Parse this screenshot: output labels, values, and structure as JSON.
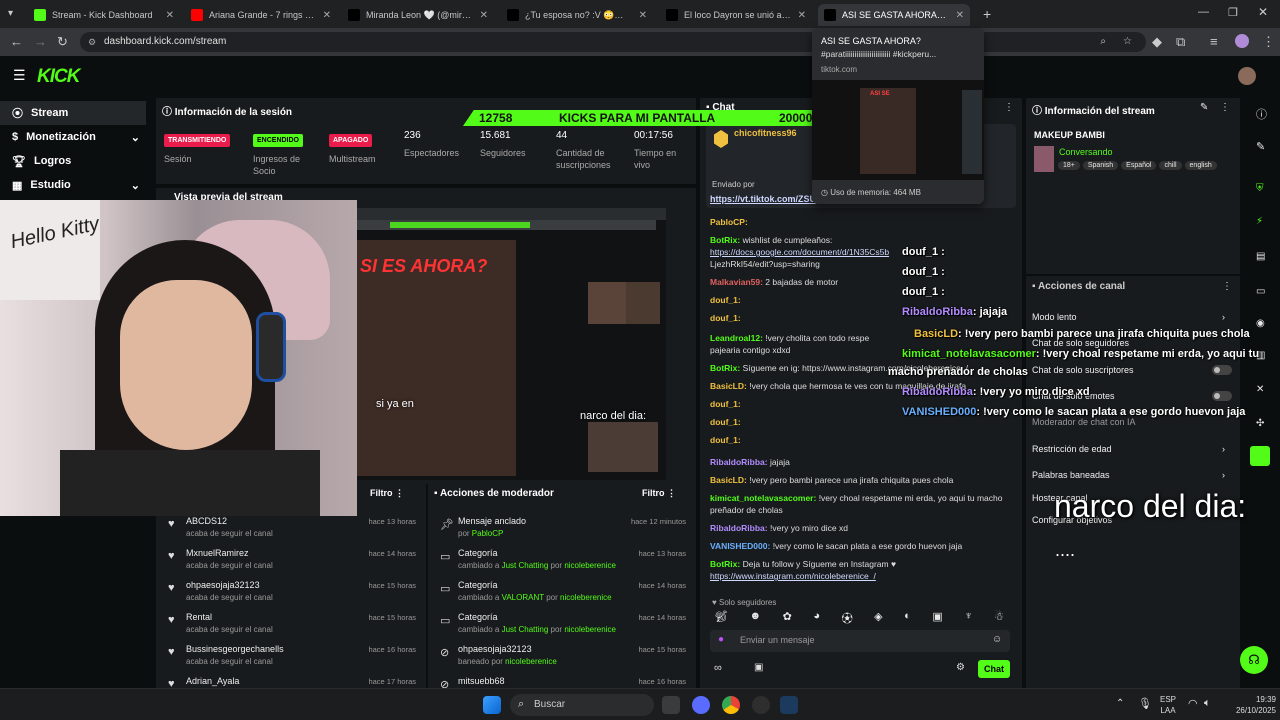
{
  "browser": {
    "tabs": [
      {
        "label": "Stream - Kick Dashboard",
        "favicon": "kick-icon",
        "color": "#53fc18"
      },
      {
        "label": "Ariana Grande - 7 rings (Official",
        "favicon": "youtube-icon",
        "color": "#ff0000"
      },
      {
        "label": "Miranda Leon 🤍 (@mirandita",
        "favicon": "tiktok-icon",
        "color": "#000000"
      },
      {
        "label": "¿Tu esposa no? :V 😳💀 #king",
        "favicon": "tiktok-icon",
        "color": "#000000"
      },
      {
        "label": "El loco Dayron se unió a los sal",
        "favicon": "tiktok-icon",
        "color": "#000000"
      },
      {
        "label": "ASI SE GASTA AHORA? #parati",
        "favicon": "tiktok-icon",
        "color": "#000000"
      }
    ],
    "url": "dashboard.kick.com/stream",
    "tooltip": {
      "title": "ASI SE GASTA AHORA?",
      "subtitle": "#paratiiiiiiiiiiiiiiiiiiiiiiii #kickperu...",
      "domain": "tiktok.com",
      "memory": "Uso de memoria: 464 MB"
    }
  },
  "nav": {
    "items": [
      {
        "label": "Stream",
        "icon": "stream-icon"
      },
      {
        "label": "Monetización",
        "icon": "dollar-icon"
      },
      {
        "label": "Logros",
        "icon": "trophy-icon"
      },
      {
        "label": "Estudio",
        "icon": "studio-icon"
      }
    ]
  },
  "session": {
    "title": "Información de la sesión",
    "status": [
      {
        "badge": "TRANSMITIENDO",
        "label": "Sesión",
        "color": "#e91c4b",
        "text": "#ffffff"
      },
      {
        "badge": "ENCENDIDO",
        "label": "Ingresos de Socio",
        "color": "#53fc18",
        "text": "#000000"
      },
      {
        "badge": "APAGADO",
        "label": "Multistream",
        "color": "#e91c4b",
        "text": "#ffffff"
      }
    ],
    "stats": [
      {
        "value": "236",
        "label": "Espectadores"
      },
      {
        "value": "15.681",
        "label": "Seguidores"
      },
      {
        "value": "44",
        "label": "Cantidad de suscripciones"
      },
      {
        "value": "00:17:56",
        "label": "Tiempo en vivo"
      }
    ]
  },
  "overlay": {
    "kicks_current": "12758",
    "kicks_title": "KICKS PARA MI PANTALLA",
    "kicks_goal": "20000",
    "caption1": "si ya en",
    "caption2": "narco del dia:",
    "big_caption": "narco del dia:",
    "dots": "....",
    "tshirt_text": "Hello Kitty"
  },
  "preview": {
    "title": "Vista previa del stream",
    "embedded_heading": "SI ES AHORA?"
  },
  "followers": {
    "filter": "Filtro",
    "rows": [
      {
        "name": "ABCDS12",
        "sub": "acaba de seguir el canal",
        "time": "hace 13 horas"
      },
      {
        "name": "MxnuelRamirez",
        "sub": "acaba de seguir el canal",
        "time": "hace 14 horas"
      },
      {
        "name": "ohpaesojaja32123",
        "sub": "acaba de seguir el canal",
        "time": "hace 15 horas"
      },
      {
        "name": "Rental",
        "sub": "acaba de seguir el canal",
        "time": "hace 15 horas"
      },
      {
        "name": "Bussinesgeorgechanells",
        "sub": "acaba de seguir el canal",
        "time": "hace 16 horas"
      },
      {
        "name": "Adrian_Ayala",
        "sub": "",
        "time": "hace 17 horas"
      }
    ]
  },
  "mod_actions": {
    "title": "Acciones de moderador",
    "filter": "Filtro",
    "rows": [
      {
        "title": "Mensaje anclado",
        "sub1": "por",
        "user": "PabloCP",
        "sub2": "",
        "user2": "",
        "time": "hace 12 minutos",
        "icon": "pin-icon"
      },
      {
        "title": "Categoría",
        "sub1": "cambiado a",
        "user": "Just Chatting",
        "sub2": "por",
        "user2": "nicoleberenice",
        "time": "hace 13 horas",
        "icon": "category-icon"
      },
      {
        "title": "Categoría",
        "sub1": "cambiado a",
        "user": "VALORANT",
        "sub2": "por",
        "user2": "nicoleberenice",
        "time": "hace 14 horas",
        "icon": "category-icon"
      },
      {
        "title": "Categoría",
        "sub1": "cambiado a",
        "user": "Just Chatting",
        "sub2": "por",
        "user2": "nicoleberenice",
        "time": "hace 14 horas",
        "icon": "category-icon"
      },
      {
        "title": "ohpaesojaja32123",
        "sub1": "baneado por",
        "user": "nicoleberenice",
        "sub2": "",
        "user2": "",
        "time": "hace 15 horas",
        "icon": "ban-icon"
      },
      {
        "title": "mitsuebb68",
        "sub1": "",
        "user": "",
        "sub2": "",
        "user2": "",
        "time": "hace 16 horas",
        "icon": "ban-icon"
      }
    ]
  },
  "chat": {
    "title": "Chat",
    "pinned_user": "chicofitness96",
    "pinned_by": "Enviado por",
    "pinned_link": "https://vt.tiktok.com/ZSU",
    "lines": [
      {
        "user": "PabloCP:",
        "text": "",
        "color": "#f0c040"
      },
      {
        "user": "BotRix:",
        "text": "wishlist de cumpleaños:",
        "color": "#53fc18"
      },
      {
        "user": "",
        "text": "https://docs.google.com/document/d/1N35Cs5b",
        "color": ""
      },
      {
        "user": "",
        "text": "LjezhRkI54/edit?usp=sharing",
        "color": ""
      },
      {
        "user": "Malkavian59:",
        "text": "2 bajadas de motor",
        "color": "#e06060"
      },
      {
        "user": "douf_1:",
        "text": "",
        "color": "#f0c040"
      },
      {
        "user": "douf_1:",
        "text": "",
        "color": "#f0c040"
      },
      {
        "user": "Leandroal12:",
        "text": "!very cholita con todo respe",
        "color": "#53fc18"
      },
      {
        "user": "",
        "text": "pajearia contigo xdxd",
        "color": ""
      },
      {
        "user": "BotRix:",
        "text": "Sígueme en ig: https://www.instagram.com/nicoleberenice_/",
        "color": "#53fc18"
      },
      {
        "user": "BasicLD:",
        "text": "!very chola que hermosa te ves con tu maquillaje de jirafa",
        "color": "#f0c040"
      },
      {
        "user": "douf_1:",
        "text": "",
        "color": "#f0c040"
      },
      {
        "user": "douf_1:",
        "text": "",
        "color": "#f0c040"
      },
      {
        "user": "douf_1:",
        "text": "",
        "color": "#f0c040"
      },
      {
        "user": "RibaldoRibba:",
        "text": "jajaja",
        "color": "#b28cff"
      },
      {
        "user": "BasicLD:",
        "text": "!very pero bambi parece una jirafa chiquita pues chola",
        "color": "#f0c040"
      },
      {
        "user": "kimicat_notelavasacomer:",
        "text": "!very choal respetame mi erda, yo aqui tu macho",
        "color": "#53fc18"
      },
      {
        "user": "",
        "text": "preñador de cholas",
        "color": ""
      },
      {
        "user": "RibaldoRibba:",
        "text": "!very yo miro dice xd",
        "color": "#b28cff"
      },
      {
        "user": "VANISHED000:",
        "text": "!very como le sacan plata a ese gordo huevon jaja",
        "color": "#6ab0ff"
      },
      {
        "user": "BotRix:",
        "text": "Deja tu follow y Sígueme en Instagram ♥",
        "color": "#53fc18"
      },
      {
        "user": "",
        "text": "https://www.instagram.com/nicoleberenice_/",
        "color": ""
      }
    ],
    "followers_only": "Solo seguidores",
    "input_placeholder": "Enviar un mensaje",
    "send_label": "Chat"
  },
  "overlay_chat": [
    {
      "user": "douf_1 :",
      "text": "",
      "color": "#ffffff"
    },
    {
      "user": "douf_1 :",
      "text": "",
      "color": "#ffffff"
    },
    {
      "user": "douf_1 :",
      "text": "",
      "color": "#ffffff"
    },
    {
      "user": "RibaldoRibba",
      "text": ": jajaja",
      "color": "#b28cff"
    },
    {
      "user": "BasicLD",
      "text": ": !very pero bambi parece una jirafa chiquita pues chola",
      "color": "#f0c040"
    },
    {
      "user": "kimicat_notelavasacomer",
      "text": ": !very choal respetame mi erda, yo aqui tu",
      "color": "#53fc18"
    },
    {
      "user": "",
      "text": "macho preñador de cholas",
      "color": "#ffffff"
    },
    {
      "user": "RibaldoRibba",
      "text": ": !very yo miro dice xd",
      "color": "#b28cff"
    },
    {
      "user": "VANISHED000",
      "text": ": !very como le sacan plata a ese gordo huevon jaja",
      "color": "#6ab0ff"
    }
  ],
  "stream_info": {
    "title": "Información del stream",
    "stream_title": "MAKEUP BAMBI",
    "category": "Conversando",
    "tags": [
      "18+",
      "Spanish",
      "Español",
      "chill",
      "english"
    ]
  },
  "channel_actions": {
    "title": "Acciones de canal",
    "rows": [
      {
        "label": "Modo lento",
        "kind": "chevron"
      },
      {
        "label": "Chat de solo seguidores",
        "kind": "text"
      },
      {
        "label": "Chat de solo suscriptores",
        "kind": "toggle"
      },
      {
        "label": "Chat de solo emotes",
        "kind": "toggle"
      },
      {
        "label": "Moderador de chat con IA",
        "kind": "text"
      },
      {
        "label": "Restricción de edad",
        "kind": "chevron"
      },
      {
        "label": "Palabras baneadas",
        "kind": "chevron"
      },
      {
        "label": "Hostear canal",
        "kind": "text"
      },
      {
        "label": "Configurar objetivos",
        "kind": "text"
      }
    ]
  },
  "taskbar": {
    "search_placeholder": "Buscar",
    "lang1": "ESP",
    "lang2": "LAA",
    "time": "19:39",
    "date": "26/10/2025"
  },
  "colors": {
    "kick_green": "#53fc18",
    "live_red": "#e91c4b"
  }
}
